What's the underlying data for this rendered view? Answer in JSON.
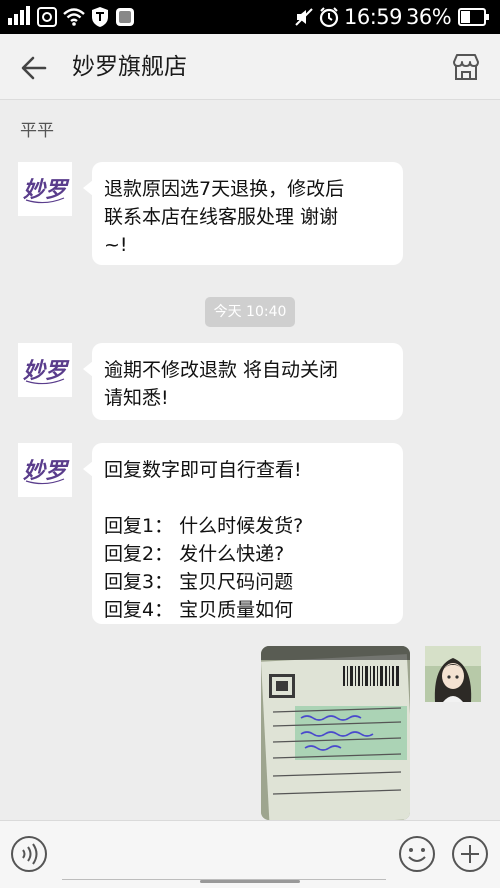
{
  "status_bar": {
    "time": "16:59",
    "battery_percent": "36%"
  },
  "header": {
    "title": "妙罗旗舰店"
  },
  "chat": {
    "sender_name": "平平",
    "brand_logo_text": "妙罗",
    "messages": [
      {
        "lines": [
          "退款原因选7天退换，修改后",
          "联系本店在线客服处理  谢谢",
          "~!"
        ]
      },
      {
        "lines": [
          "逾期不修改退款 将自动关闭",
          "请知悉!"
        ]
      },
      {
        "lines": [
          "回复数字即可自行查看!",
          "",
          "回复1：  什么时候发货?",
          "回复2：  发什么快递?",
          "回复3：  宝贝尺码问题",
          "回复4：  宝贝质量如何"
        ]
      }
    ],
    "timestamp": "今天 10:40"
  },
  "colors": {
    "background": "#ededed",
    "bubble": "#ffffff",
    "logo_purple": "#5a3d8c"
  },
  "icons": [
    "back-icon",
    "store-icon",
    "voice-icon",
    "emoji-icon",
    "plus-icon"
  ]
}
